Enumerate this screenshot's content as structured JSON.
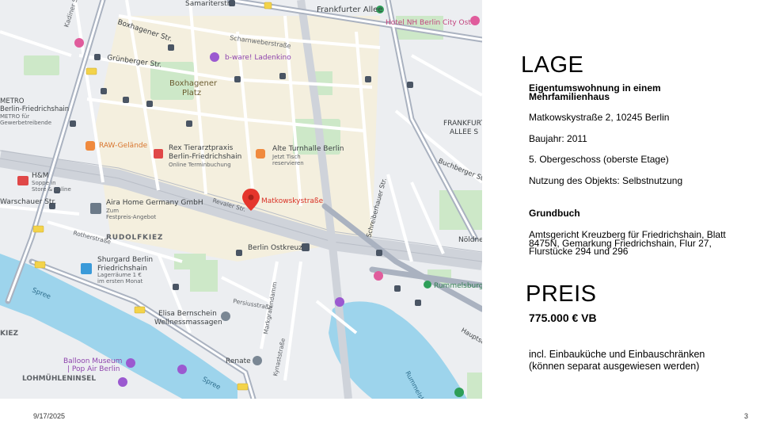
{
  "map": {
    "labels": {
      "samariterstr": "Samariterstr.",
      "frankfurter_allee": "Frankfurter Allee",
      "hotel": "Hotel NH Berlin City Ost",
      "boxhagener_str": "Boxhagener Str.",
      "scharnweberstr": "Scharnweberstraße",
      "rigaer": "Kadiner Str.",
      "bware": "b-ware! Ladenkino",
      "gruenberger": "Grünberger Str.",
      "boxhagener_platz_1": "Boxhagener",
      "boxhagener_platz_2": "Platz",
      "metro_1": "METRO",
      "metro_2": "Berlin-Friedrichshain",
      "metro_3": "METRO für",
      "metro_4": "Gewerbetreibende",
      "frankfurter_allee_s_1": "FRANKFURT",
      "frankfurter_allee_s_2": "ALLEE S",
      "raw": "RAW-Gelände",
      "rex_1": "Rex Tierarztpraxis",
      "rex_2": "Berlin-Friedrichshain",
      "rex_3": "Online Terminbuchung",
      "turnhalle_1": "Alte Turnhalle Berlin",
      "turnhalle_2": "Jetzt Tisch",
      "turnhalle_3": "reservieren",
      "buchberger": "Buchberger Str.",
      "hm_1": "H&M",
      "hm_2": "Soppe in",
      "hm_3": "Store & online",
      "warschauer": "Warschauer Str.",
      "aira_1": "Aira Home Germany GmbH",
      "aira_2": "Zum",
      "aira_3": "Festpreis-Angebot",
      "matkowsky": "Matkowskystraße",
      "revaler": "Revaler Str.",
      "rudolfkiez": "RUDOLFKIEZ",
      "rotherstr": "Rotherstraße",
      "ostkreuz": "Berlin Ostkreuz",
      "schreiber": "Schreiberhauer Str.",
      "noeldner": "Nöldner",
      "shurgard_1": "Shurgard Berlin",
      "shurgard_2": "Friedrichshain",
      "shurgard_3": "Lagerräume 1 €",
      "shurgard_4": "im ersten Monat",
      "rummelsburg": "Rummelsburg",
      "spree_1": "Spree",
      "spree_2": "Spree",
      "persius": "Persiusstraße",
      "markgrafen": "Markgrafendamm",
      "kynast": "Kynaststraße",
      "elisa_1": "Elisa Bernschein",
      "elisa_2": "Wellnessmassagen",
      "kiez": "KIEZ",
      "renate": "Renate",
      "balloon_1": "Balloon Museum",
      "balloon_2": "| Pop Air Berlin",
      "lohmuehle": "LOHMÜHLENINSEL",
      "rummelsburger": "Rummelsb",
      "hauptstr": "Hauptst"
    }
  },
  "lage": {
    "heading": "LAGE",
    "type_line1": "Eigentumswohnung in einem",
    "type_line2": "Mehrfamilienhaus",
    "address": "Matkowskystraße 2, 10245 Berlin",
    "baujahr": "Baujahr: 2011",
    "etage": "5. Obergeschoss (oberste Etage)",
    "nutzung": "Nutzung des Objekts: Selbstnutzung",
    "grundbuch_heading": "Grundbuch",
    "grundbuch_line1": "Amtsgericht Kreuzberg für Friedrichshain, Blatt",
    "grundbuch_line2": "8475N, Gemarkung Friedrichshain, Flur 27,",
    "grundbuch_line3": "Flurstücke 294 und 296"
  },
  "preis": {
    "heading": "PREIS",
    "amount": "775.000 € VB",
    "note_line1": "incl. Einbauküche und Einbauschränken",
    "note_line2": "(können separat ausgewiesen werden)"
  },
  "footer": {
    "date": "9/17/2025",
    "page": "3"
  }
}
